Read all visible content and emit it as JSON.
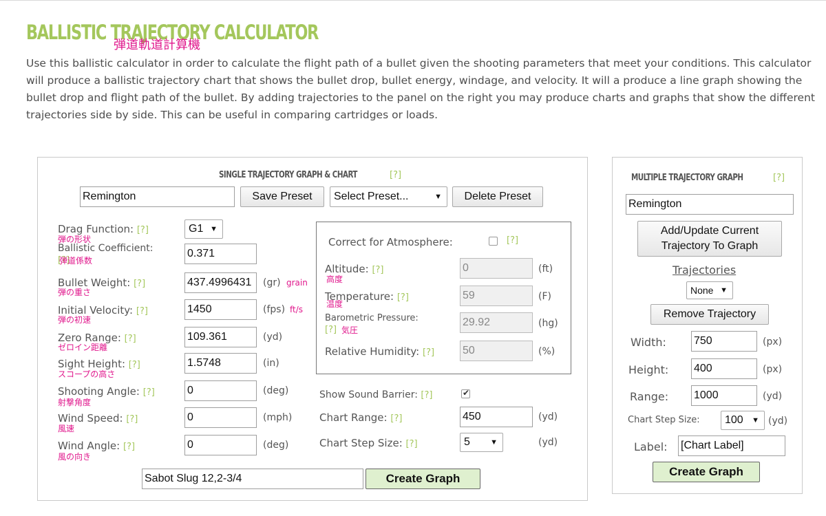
{
  "header": {
    "title": "BALLISTIC TRAJECTORY CALCULATOR",
    "title_jp": "弾道軌道計算機",
    "intro": "Use this ballistic calculator in order to calculate the flight path of a bullet given the shooting parameters that meet your conditions. This calculator will produce a ballistic trajectory chart that shows the bullet drop, bullet energy, windage, and velocity. It will a produce a line graph showing the bullet drop and flight path of the bullet. By adding trajectories to the panel on the right you may produce charts and graphs that show the different trajectories side by side. This can be useful in comparing cartridges or loads."
  },
  "help_marker": "[?]",
  "single": {
    "title": "SINGLE TRAJECTORY GRAPH & CHART",
    "preset_name": "Remington",
    "save_preset": "Save Preset",
    "select_preset": "Select Preset...",
    "delete_preset": "Delete Preset",
    "fields": {
      "drag": {
        "label": "Drag Function:",
        "jp": "弾の形状",
        "value": "G1"
      },
      "bc": {
        "label": "Ballistic Coefficient:",
        "jp": "弾道係数",
        "value": "0.371"
      },
      "weight": {
        "label": "Bullet Weight:",
        "jp": "弾の重さ",
        "value": "437.4996431",
        "unit": "(gr)",
        "unit_note": "grain"
      },
      "velocity": {
        "label": "Initial Velocity:",
        "jp": "弾の初速",
        "value": "1450",
        "unit": "(fps)",
        "unit_note": "ft/s"
      },
      "zero": {
        "label": "Zero Range:",
        "jp": "ゼロイン距離",
        "value": "109.361",
        "unit": "(yd)"
      },
      "sight": {
        "label": "Sight Height:",
        "jp": "スコープの高さ",
        "value": "1.5748",
        "unit": "(in)"
      },
      "angle": {
        "label": "Shooting Angle:",
        "jp": "射撃角度",
        "value": "0",
        "unit": "(deg)"
      },
      "wind_speed": {
        "label": "Wind Speed:",
        "jp": "風速",
        "value": "0",
        "unit": "(mph)"
      },
      "wind_angle": {
        "label": "Wind Angle:",
        "jp": "風の向き",
        "value": "0",
        "unit": "(deg)"
      }
    },
    "atmosphere": {
      "correct_label": "Correct for Atmosphere:",
      "altitude": {
        "label": "Altitude:",
        "jp": "高度",
        "value": "0",
        "unit": "(ft)"
      },
      "temperature": {
        "label": "Temperature:",
        "jp": "温度",
        "value": "59",
        "unit": "(F)"
      },
      "pressure": {
        "label": "Barometric Pressure:",
        "jp": "気圧",
        "value": "29.92",
        "unit": "(hg)"
      },
      "humidity": {
        "label": "Relative Humidity:",
        "value": "50",
        "unit": "(%)"
      }
    },
    "sound_barrier_label": "Show Sound Barrier:",
    "chart_range": {
      "label": "Chart Range:",
      "value": "450",
      "unit": "(yd)"
    },
    "chart_step": {
      "label": "Chart Step Size:",
      "value": "5",
      "unit": "(yd)"
    },
    "graph_label": "Sabot Slug 12,2-3/4",
    "create_graph": "Create Graph"
  },
  "multiple": {
    "title": "MULTIPLE TRAJECTORY GRAPH",
    "name": "Remington",
    "add_update": "Add/Update Current Trajectory To Graph",
    "trajectories_label": "Trajectories",
    "trajectories_value": "None",
    "remove": "Remove Trajectory",
    "width": {
      "label": "Width:",
      "value": "750",
      "unit": "(px)"
    },
    "height": {
      "label": "Height:",
      "value": "400",
      "unit": "(px)"
    },
    "range": {
      "label": "Range:",
      "value": "1000",
      "unit": "(yd)"
    },
    "step": {
      "label": "Chart Step Size:",
      "value": "100",
      "unit": "(yd)"
    },
    "chart_label": {
      "label": "Label:",
      "value": "[Chart Label]"
    },
    "create_graph": "Create Graph"
  },
  "colors": {
    "accent_green": "#a4c75c",
    "annotation_pink": "#e0178c",
    "button_green": "#dff0cf"
  }
}
